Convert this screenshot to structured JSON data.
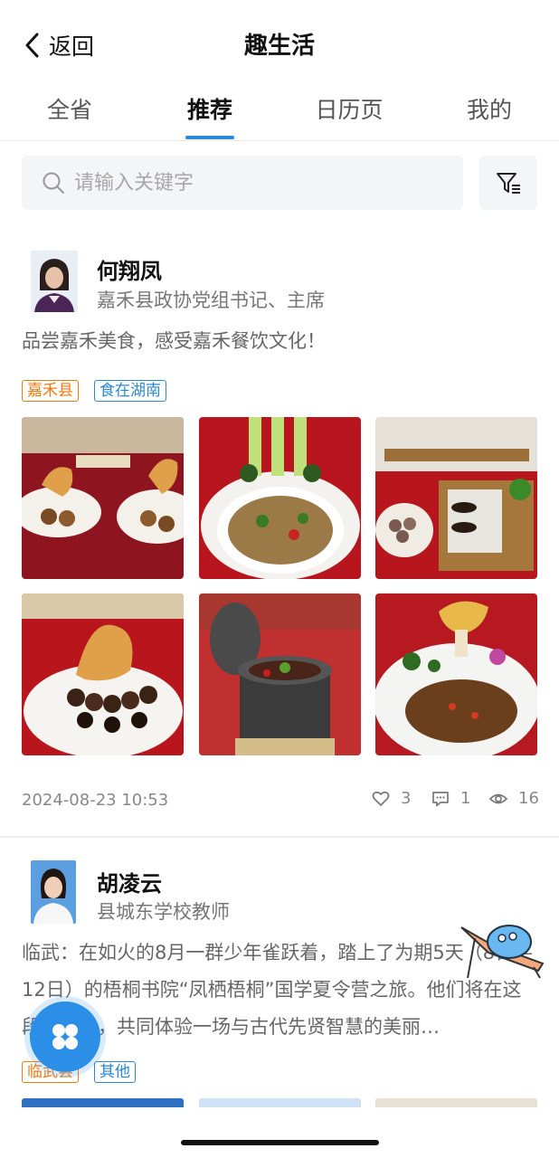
{
  "header": {
    "back_label": "返回",
    "title": "趣生活"
  },
  "tabs": [
    {
      "label": "全省"
    },
    {
      "label": "推荐"
    },
    {
      "label": "日历页"
    },
    {
      "label": "我的"
    }
  ],
  "search": {
    "placeholder": "请输入关键字"
  },
  "posts": [
    {
      "author": "何翔凤",
      "role": "嘉禾县政协党组书记、主席",
      "text": "品尝嘉禾美食，感受嘉禾餐饮文化！",
      "tags": [
        "嘉禾县",
        "食在湖南"
      ],
      "date": "2024-08-23 10:53",
      "likes": "3",
      "comments": "1",
      "views": "16"
    },
    {
      "author": "胡凌云",
      "role": "县城东学校教师",
      "text": "临武：在如火的8月一群少年雀跃着，踏上了为期5天（8日—12日）的梧桐书院“凤栖梧桐”国学夏令营之旅。他们将在这段时光中，共同体验一场与古代先贤智慧的美丽…",
      "tags": [
        "临武县",
        "其他"
      ]
    }
  ]
}
